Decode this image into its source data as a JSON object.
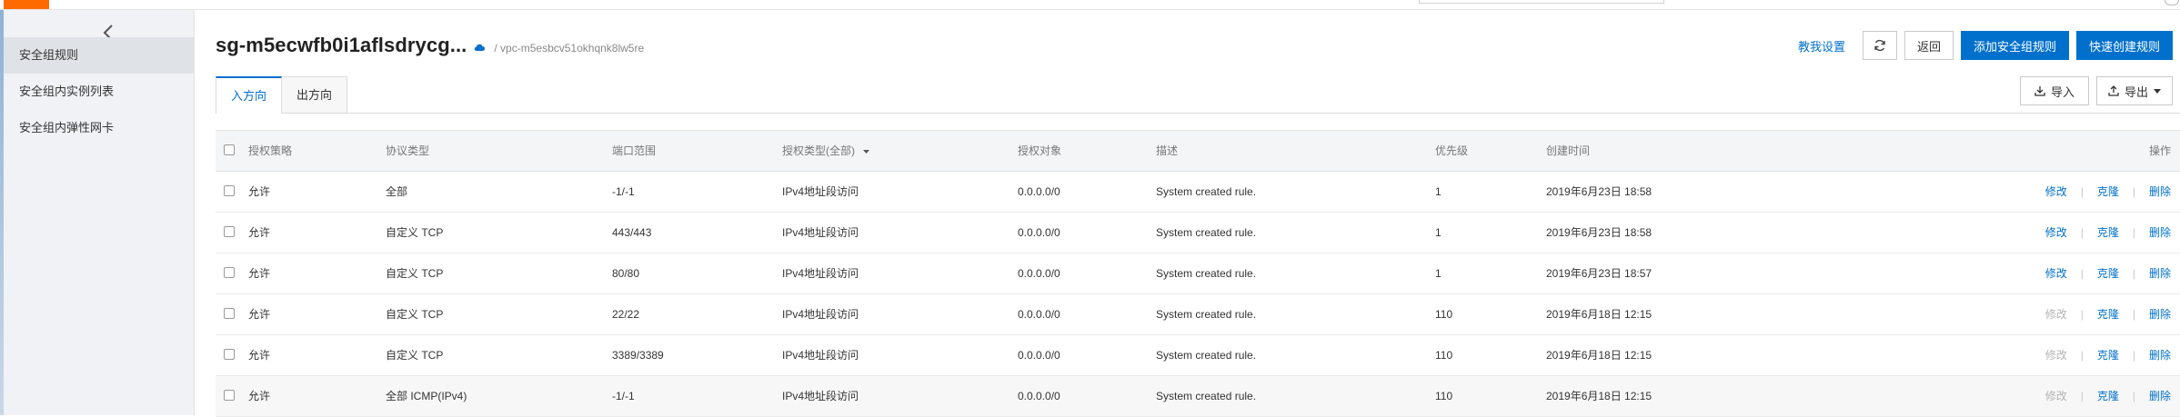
{
  "page": {
    "title": "sg-m5ecwfb0i1aflsdrycg...",
    "vpc": "/ vpc-m5esbcv51okhqnk8lw5re"
  },
  "sidebar": {
    "items": [
      {
        "label": "安全组规则",
        "active": true
      },
      {
        "label": "安全组内实例列表",
        "active": false
      },
      {
        "label": "安全组内弹性网卡",
        "active": false
      }
    ]
  },
  "header_actions": {
    "teach": "教我设置",
    "back": "返回",
    "add_rule": "添加安全组规则",
    "quick_rule": "快速创建规则"
  },
  "tabs": [
    {
      "label": "入方向",
      "active": true
    },
    {
      "label": "出方向",
      "active": false
    }
  ],
  "tools": {
    "import": "导入",
    "export": "导出"
  },
  "table": {
    "columns": [
      "授权策略",
      "协议类型",
      "端口范围",
      "授权类型(全部)",
      "授权对象",
      "描述",
      "优先级",
      "创建时间",
      "操作"
    ],
    "actions": {
      "edit": "修改",
      "clone": "克隆",
      "delete": "删除"
    },
    "rows": [
      {
        "policy": "允许",
        "protocol": "全部",
        "port": "-1/-1",
        "auth_type": "IPv4地址段访问",
        "object": "0.0.0.0/0",
        "desc": "System created rule.",
        "priority": "1",
        "created": "2019年6月23日 18:58",
        "edit_enabled": true
      },
      {
        "policy": "允许",
        "protocol": "自定义 TCP",
        "port": "443/443",
        "auth_type": "IPv4地址段访问",
        "object": "0.0.0.0/0",
        "desc": "System created rule.",
        "priority": "1",
        "created": "2019年6月23日 18:58",
        "edit_enabled": true
      },
      {
        "policy": "允许",
        "protocol": "自定义 TCP",
        "port": "80/80",
        "auth_type": "IPv4地址段访问",
        "object": "0.0.0.0/0",
        "desc": "System created rule.",
        "priority": "1",
        "created": "2019年6月23日 18:57",
        "edit_enabled": true
      },
      {
        "policy": "允许",
        "protocol": "自定义 TCP",
        "port": "22/22",
        "auth_type": "IPv4地址段访问",
        "object": "0.0.0.0/0",
        "desc": "System created rule.",
        "priority": "110",
        "created": "2019年6月18日 12:15",
        "edit_enabled": false
      },
      {
        "policy": "允许",
        "protocol": "自定义 TCP",
        "port": "3389/3389",
        "auth_type": "IPv4地址段访问",
        "object": "0.0.0.0/0",
        "desc": "System created rule.",
        "priority": "110",
        "created": "2019年6月18日 12:15",
        "edit_enabled": false
      },
      {
        "policy": "允许",
        "protocol": "全部 ICMP(IPv4)",
        "port": "-1/-1",
        "auth_type": "IPv4地址段访问",
        "object": "0.0.0.0/0",
        "desc": "System created rule.",
        "priority": "110",
        "created": "2019年6月18日 12:15",
        "edit_enabled": false
      }
    ]
  },
  "colors": {
    "primary": "#0070cc",
    "brand_orange": "#ff6a00",
    "sidebar_bg": "#f0f2f5",
    "disabled_link": "#b3b3b3"
  },
  "icons": [
    "chevron-left-icon",
    "cloud-icon",
    "refresh-icon",
    "download-icon",
    "upload-icon",
    "caret-down-icon",
    "sort-caret-icon"
  ]
}
